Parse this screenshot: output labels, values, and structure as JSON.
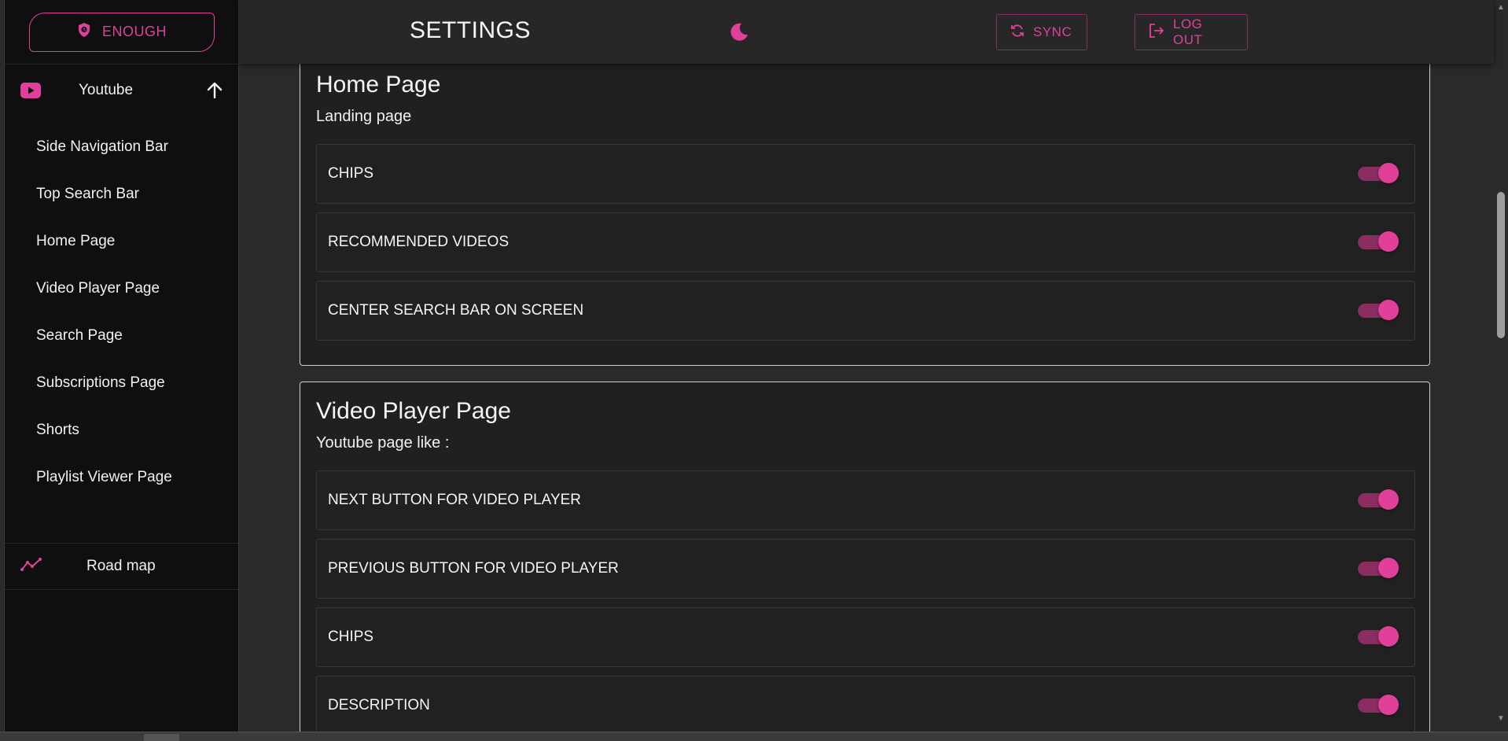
{
  "brand": {
    "label": "ENOUGH",
    "icon": "shield-icon",
    "accent": "#e0409a"
  },
  "sidebar": {
    "section": {
      "label": "Youtube",
      "icon": "youtube-icon",
      "toggle_icon": "arrow-up-icon"
    },
    "items": [
      {
        "label": "Side Navigation Bar"
      },
      {
        "label": "Top Search Bar"
      },
      {
        "label": "Home Page"
      },
      {
        "label": "Video Player Page"
      },
      {
        "label": "Search Page"
      },
      {
        "label": "Subscriptions Page"
      },
      {
        "label": "Shorts"
      },
      {
        "label": "Playlist Viewer Page"
      }
    ],
    "road_map": {
      "label": "Road map",
      "icon": "trend-line-icon"
    }
  },
  "header": {
    "title": "SETTINGS",
    "theme_icon": "moon-icon",
    "sync_label": "SYNC",
    "logout_label": "LOG OUT"
  },
  "cards": {
    "home": {
      "title": "Home Page",
      "subtitle": "Landing page",
      "options": [
        {
          "label": "CHIPS",
          "enabled": true
        },
        {
          "label": "RECOMMENDED VIDEOS",
          "enabled": true
        },
        {
          "label": "CENTER SEARCH BAR ON SCREEN",
          "enabled": true
        }
      ]
    },
    "video": {
      "title": "Video Player Page",
      "subtitle": "Youtube page like :",
      "options": [
        {
          "label": "NEXT BUTTON FOR VIDEO PLAYER",
          "enabled": true
        },
        {
          "label": "PREVIOUS BUTTON FOR VIDEO PLAYER",
          "enabled": true
        },
        {
          "label": "CHIPS",
          "enabled": true
        },
        {
          "label": "DESCRIPTION",
          "enabled": true
        }
      ]
    }
  }
}
